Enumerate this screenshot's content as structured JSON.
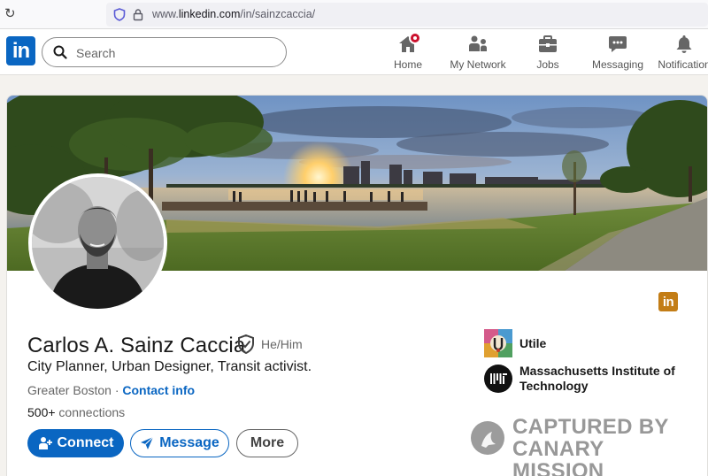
{
  "browser": {
    "url_prefix": "www.",
    "url_domain": "linkedin.com",
    "url_path": "/in/sainzcaccia/"
  },
  "nav": {
    "logo": "in",
    "search_placeholder": "Search",
    "items": [
      {
        "label": "Home",
        "icon": "home-icon"
      },
      {
        "label": "My Network",
        "icon": "network-icon"
      },
      {
        "label": "Jobs",
        "icon": "briefcase-icon"
      },
      {
        "label": "Messaging",
        "icon": "messaging-icon"
      },
      {
        "label": "Notification",
        "icon": "bell-icon"
      }
    ]
  },
  "profile": {
    "name": "Carlos A. Sainz Caccia",
    "pronouns": "He/Him",
    "headline": "City Planner, Urban Designer, Transit activist.",
    "location": "Greater Boston",
    "location_separator": " · ",
    "contact_info": "Contact info",
    "connections_count": "500+",
    "connections_label": " connections",
    "linkedin_badge": "in"
  },
  "actions": {
    "connect": "Connect",
    "message": "Message",
    "more": "More"
  },
  "organizations": [
    {
      "name": "Utile"
    },
    {
      "name": "Massachusetts Institute of Technology"
    }
  ],
  "watermark": {
    "line1": "CAPTURED BY",
    "line2": "CANARY MISSION"
  },
  "colors": {
    "linkedin_blue": "#0a66c2",
    "notification_red": "#cb112d",
    "badge_gold": "#c37d16"
  }
}
